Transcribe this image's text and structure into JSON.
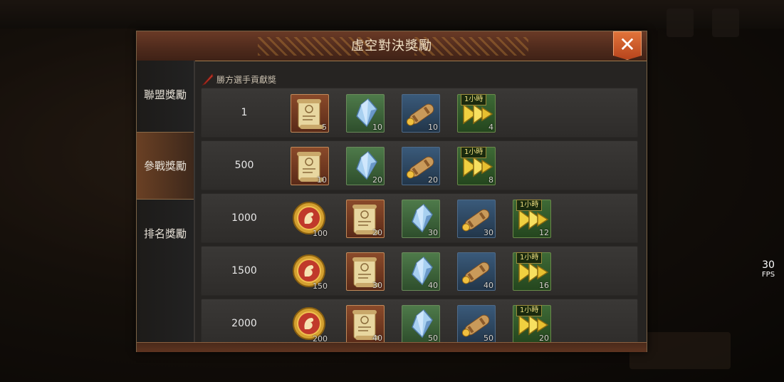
{
  "dialog": {
    "title": "虛空對決獎勵",
    "close_label": "✕"
  },
  "tabs": [
    {
      "label": "聯盟獎勵",
      "active": false
    },
    {
      "label": "參戰獎勵",
      "active": true
    },
    {
      "label": "排名獎勵",
      "active": false
    }
  ],
  "section": {
    "title": "勝方選手貢獻獎"
  },
  "rows": [
    {
      "rank": "1",
      "items": [
        {
          "type": "scroll",
          "qty": "5"
        },
        {
          "type": "crystal",
          "qty": "10"
        },
        {
          "type": "map",
          "qty": "10"
        },
        {
          "type": "speedup",
          "qty": "4",
          "badge": "1小時"
        }
      ]
    },
    {
      "rank": "500",
      "items": [
        {
          "type": "scroll",
          "qty": "10"
        },
        {
          "type": "crystal",
          "qty": "20"
        },
        {
          "type": "map",
          "qty": "20"
        },
        {
          "type": "speedup",
          "qty": "8",
          "badge": "1小時"
        }
      ]
    },
    {
      "rank": "1000",
      "items": [
        {
          "type": "coin",
          "qty": "100"
        },
        {
          "type": "scroll",
          "qty": "20"
        },
        {
          "type": "crystal",
          "qty": "30"
        },
        {
          "type": "map",
          "qty": "30"
        },
        {
          "type": "speedup",
          "qty": "12",
          "badge": "1小時"
        }
      ]
    },
    {
      "rank": "1500",
      "items": [
        {
          "type": "coin",
          "qty": "150"
        },
        {
          "type": "scroll",
          "qty": "30"
        },
        {
          "type": "crystal",
          "qty": "40"
        },
        {
          "type": "map",
          "qty": "40"
        },
        {
          "type": "speedup",
          "qty": "16",
          "badge": "1小時"
        }
      ]
    },
    {
      "rank": "2000",
      "items": [
        {
          "type": "coin",
          "qty": "200"
        },
        {
          "type": "scroll",
          "qty": "40"
        },
        {
          "type": "crystal",
          "qty": "50"
        },
        {
          "type": "map",
          "qty": "50"
        },
        {
          "type": "speedup",
          "qty": "20",
          "badge": "1小時"
        }
      ]
    }
  ],
  "fps": {
    "value": "30",
    "label": "FPS"
  }
}
